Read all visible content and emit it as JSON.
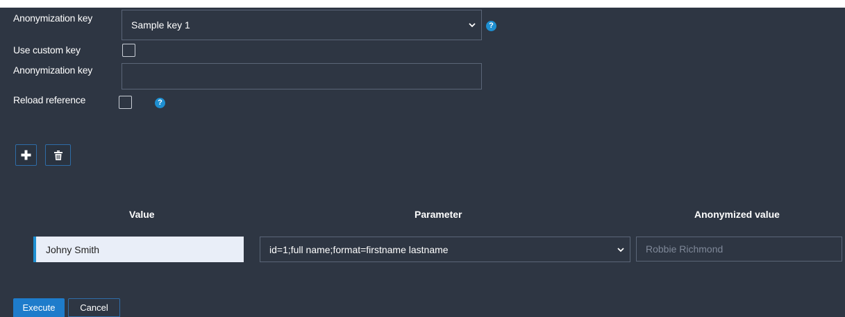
{
  "form": {
    "anonymization_key_label": "Anonymization key",
    "anonymization_key_selected": "Sample key 1",
    "use_custom_key_label": "Use custom key",
    "custom_key_label": "Anonymization key",
    "custom_key_value": "",
    "reload_reference_label": "Reload reference",
    "help_glyph": "?"
  },
  "toolbar": {
    "add_icon": "plus-icon",
    "delete_icon": "trash-icon"
  },
  "table": {
    "headers": [
      "Value",
      "Parameter",
      "Anonymized value"
    ],
    "row": {
      "value": "Johny Smith",
      "parameter": "id=1;full name;format=firstname lastname",
      "anonymized_value": "Robbie Richmond"
    }
  },
  "actions": {
    "execute_label": "Execute",
    "cancel_label": "Cancel"
  },
  "colors": {
    "background": "#2e3643",
    "accent": "#1e8fd1",
    "primary_button": "#1e7ccb"
  }
}
